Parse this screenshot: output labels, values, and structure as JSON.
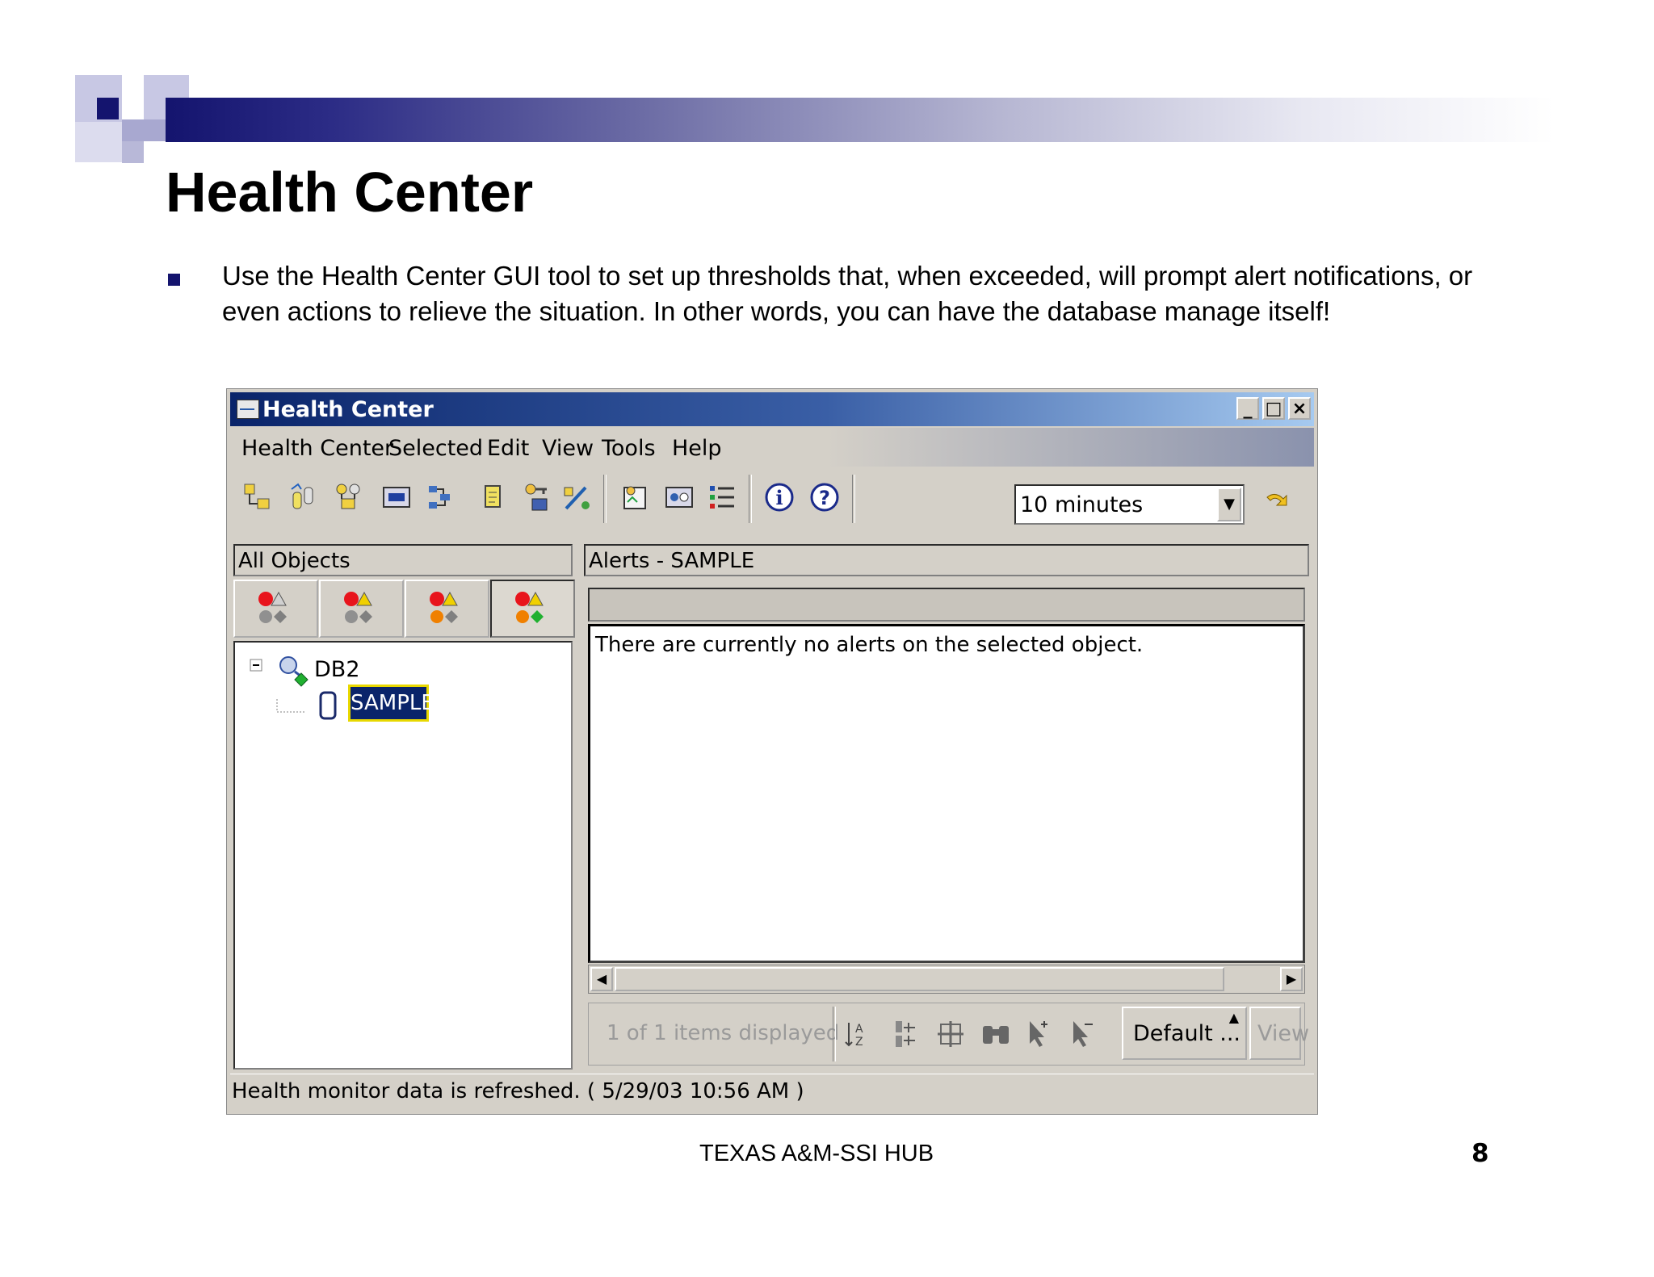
{
  "slide": {
    "title": "Health Center",
    "bullet": "Use the Health Center GUI tool to set up thresholds that, when exceeded, will prompt alert notifications, or even actions to relieve the situation. In other words, you can have the database manage itself!",
    "footer": "TEXAS A&M-SSI HUB",
    "page_number": "8"
  },
  "window": {
    "title": "Health Center",
    "controls": [
      "minimize-icon",
      "maximize-icon",
      "close-icon"
    ],
    "menu": [
      "Health Center",
      "Selected",
      "Edit",
      "View",
      "Tools",
      "Help"
    ],
    "toolbar_icons": [
      "control-center-icon",
      "replication-center-icon",
      "satellite-admin-icon",
      "command-center-icon",
      "task-center-icon",
      "journal-icon",
      "license-center-icon",
      "development-center-icon",
      "tools-settings-icon",
      "health-indicator-settings-icon",
      "recommendations-icon",
      "info-icon",
      "help-icon"
    ],
    "refresh_interval": "10 minutes",
    "refresh_icon": "refresh-icon",
    "left_pane": {
      "header": "All Objects",
      "filter_tabs": [
        "alarm-filter-icon",
        "alarm-warning-filter-icon",
        "alarm-warning-attention-filter-icon",
        "all-states-filter-icon"
      ],
      "active_filter": 3,
      "tree": [
        {
          "label": "DB2",
          "icon": "instance-icon",
          "expanded": true
        },
        {
          "label": "SAMPLE",
          "icon": "database-icon",
          "selected": true
        }
      ]
    },
    "right_pane": {
      "header": "Alerts - SAMPLE",
      "message": "There are currently no alerts on the selected object.",
      "items_displayed": "1 of 1 items displayed",
      "view_buttons": [
        "sort-icon",
        "filter-icon",
        "customize-columns-icon",
        "find-icon",
        "select-all-icon",
        "deselect-all-icon"
      ],
      "default_view": "Default ...",
      "view_label": "View"
    },
    "status": "Health monitor data is refreshed. ( 5/29/03 10:56 AM )"
  },
  "colors": {
    "slide_accent": "#14146e",
    "titlebar": "#0a246a",
    "window_face": "#d4d0c8",
    "selection": "#0a246a",
    "alarm": "#e8141c",
    "warning": "#f0d000",
    "attention": "#f08000",
    "normal": "#20b030"
  }
}
